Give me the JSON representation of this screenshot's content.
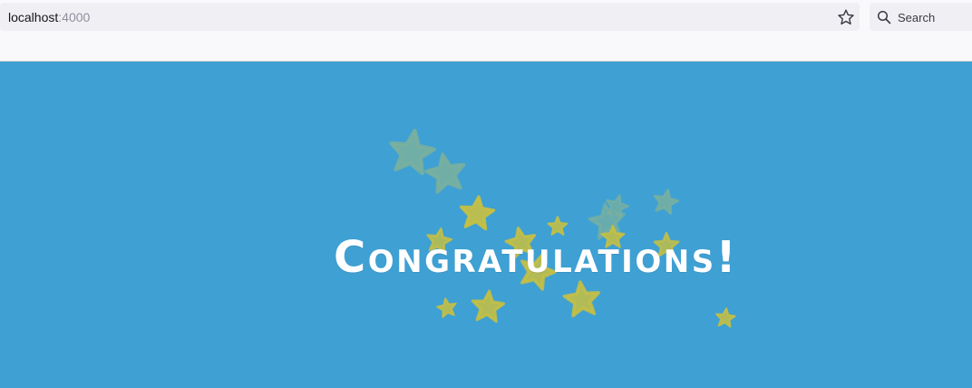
{
  "browser": {
    "url_host": "localhost",
    "url_port": ":4000",
    "search_placeholder": "Search",
    "icons": {
      "bookmark": "star-outline",
      "search": "magnifier"
    }
  },
  "page": {
    "background_color": "#3ea0d3",
    "headline": "Congratulations!",
    "headline_color": "#ffffff",
    "decoration": {
      "type": "stars",
      "colors": [
        "#c8c041",
        "#7ab09e"
      ]
    }
  }
}
